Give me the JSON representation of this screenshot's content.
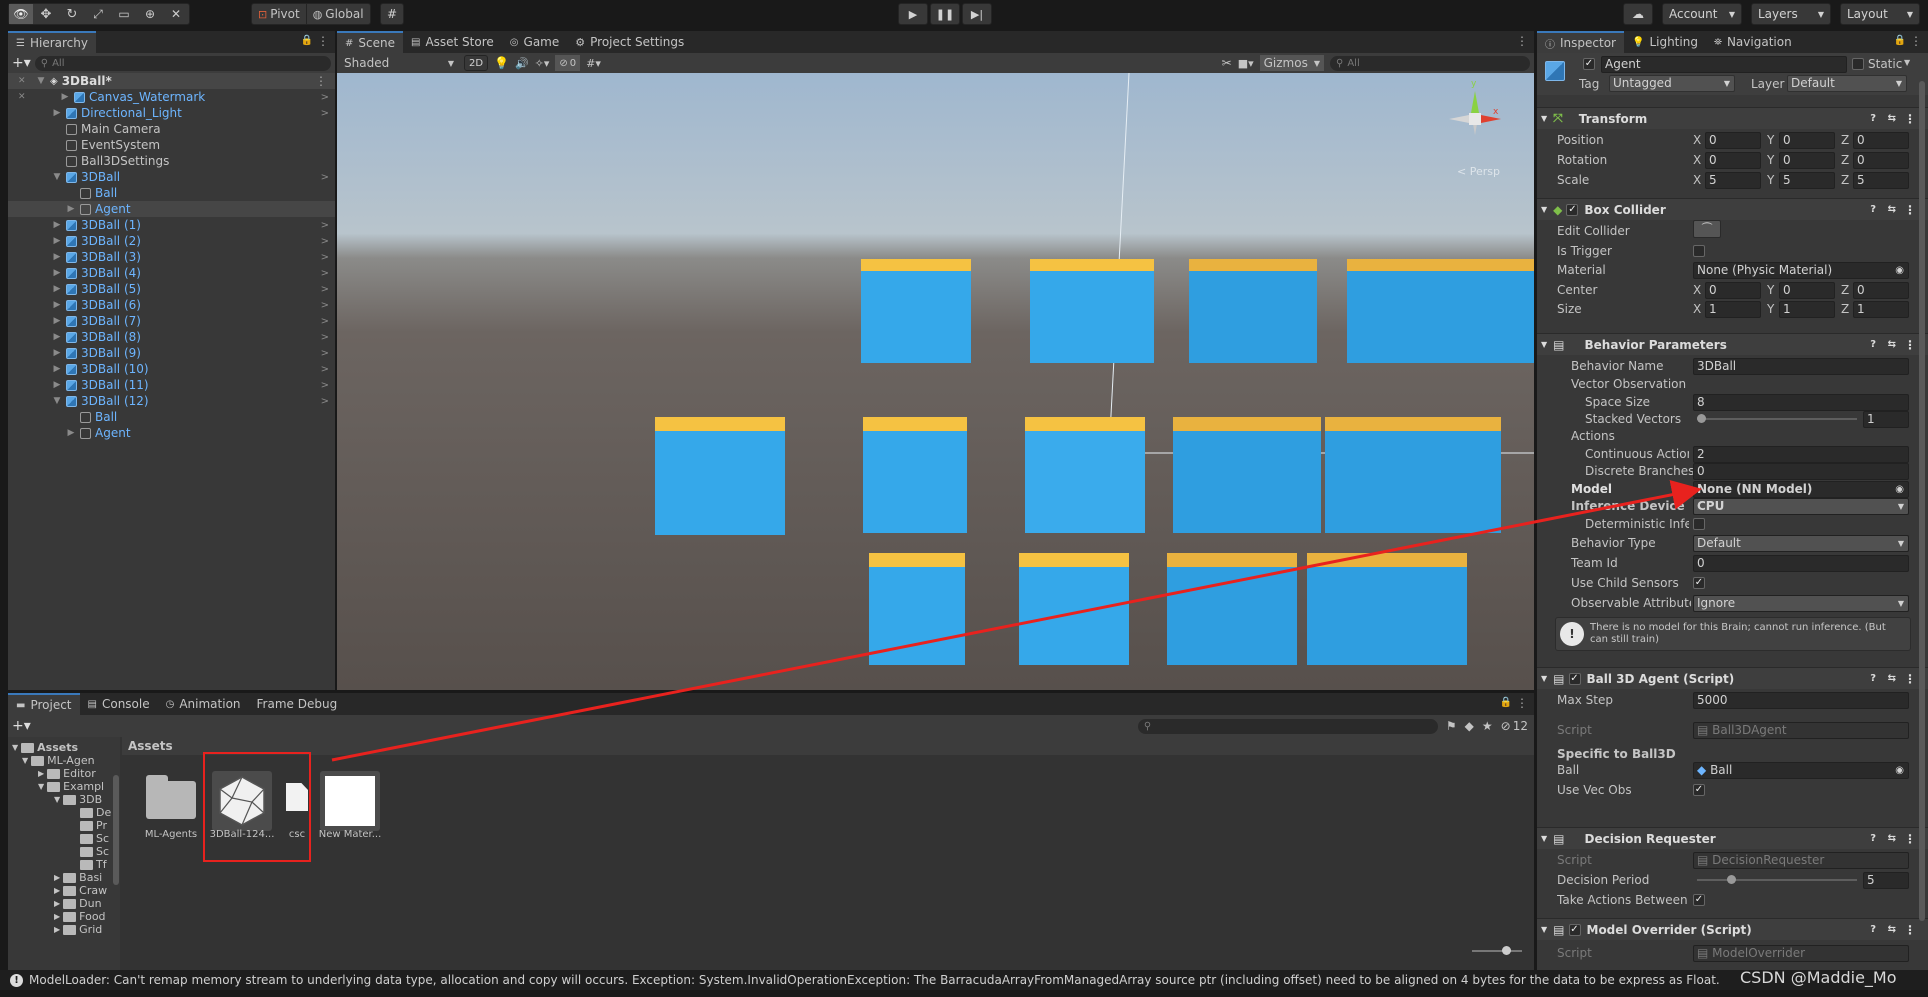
{
  "toolbar": {
    "pivot": "Pivot",
    "global": "Global",
    "account": "Account",
    "layers": "Layers",
    "layout": "Layout"
  },
  "hierarchy": {
    "tab": "Hierarchy",
    "search_placeholder": "All",
    "scene": "3DBall*",
    "items": [
      {
        "label": "Canvas_Watermark",
        "prefab": true
      },
      {
        "label": "Directional_Light",
        "prefab": true
      },
      {
        "label": "Main Camera",
        "prefab": false
      },
      {
        "label": "EventSystem",
        "prefab": false
      },
      {
        "label": "Ball3DSettings",
        "prefab": false
      },
      {
        "label": "3DBall",
        "prefab": true
      },
      {
        "label": "Ball",
        "prefab": false
      },
      {
        "label": "Agent",
        "prefab": false
      },
      {
        "label": "3DBall (1)",
        "prefab": true
      },
      {
        "label": "3DBall (2)",
        "prefab": true
      },
      {
        "label": "3DBall (3)",
        "prefab": true
      },
      {
        "label": "3DBall (4)",
        "prefab": true
      },
      {
        "label": "3DBall (5)",
        "prefab": true
      },
      {
        "label": "3DBall (6)",
        "prefab": true
      },
      {
        "label": "3DBall (7)",
        "prefab": true
      },
      {
        "label": "3DBall (8)",
        "prefab": true
      },
      {
        "label": "3DBall (9)",
        "prefab": true
      },
      {
        "label": "3DBall (10)",
        "prefab": true
      },
      {
        "label": "3DBall (11)",
        "prefab": true
      },
      {
        "label": "3DBall (12)",
        "prefab": true
      },
      {
        "label": "Ball",
        "prefab": false
      },
      {
        "label": "Agent",
        "prefab": false
      }
    ]
  },
  "scene_view": {
    "tabs": [
      "Scene",
      "Asset Store",
      "Game",
      "Project Settings"
    ],
    "shading": "Shaded",
    "mode_2d": "2D",
    "hidden_count": "0",
    "gizmos": "Gizmos",
    "search_placeholder": "All",
    "persp": "< Persp",
    "axis_x": "x",
    "axis_y": "y"
  },
  "project": {
    "tabs": [
      "Project",
      "Console",
      "Animation",
      "Frame Debug"
    ],
    "breadcrumb": "Assets",
    "hidden_count": "12",
    "tree": [
      {
        "label": "Assets",
        "depth": 0
      },
      {
        "label": "ML-Agen",
        "depth": 1
      },
      {
        "label": "Editor",
        "depth": 2
      },
      {
        "label": "Exampl",
        "depth": 2
      },
      {
        "label": "3DB",
        "depth": 3
      },
      {
        "label": "De",
        "depth": 4
      },
      {
        "label": "Pr",
        "depth": 4
      },
      {
        "label": "Sc",
        "depth": 4
      },
      {
        "label": "Sc",
        "depth": 4
      },
      {
        "label": "Tf",
        "depth": 4
      },
      {
        "label": "Basi",
        "depth": 3
      },
      {
        "label": "Craw",
        "depth": 3
      },
      {
        "label": "Dun",
        "depth": 3
      },
      {
        "label": "Food",
        "depth": 3
      },
      {
        "label": "Grid",
        "depth": 3
      }
    ],
    "assets": [
      {
        "label": "ML-Agents",
        "kind": "folder"
      },
      {
        "label": "3DBall-124...",
        "kind": "model"
      },
      {
        "label": "csc",
        "kind": "file"
      },
      {
        "label": "New Mater...",
        "kind": "material"
      }
    ]
  },
  "inspector": {
    "tabs": [
      "Inspector",
      "Lighting",
      "Navigation"
    ],
    "object_name": "Agent",
    "static_label": "Static",
    "tag_label": "Tag",
    "tag_value": "Untagged",
    "layer_label": "Layer",
    "layer_value": "Default",
    "transform": {
      "title": "Transform",
      "rows": [
        {
          "label": "Position",
          "x": "0",
          "y": "0",
          "z": "0"
        },
        {
          "label": "Rotation",
          "x": "0",
          "y": "0",
          "z": "0"
        },
        {
          "label": "Scale",
          "x": "5",
          "y": "5",
          "z": "5"
        }
      ]
    },
    "box_collider": {
      "title": "Box Collider",
      "edit_collider": "Edit Collider",
      "is_trigger": "Is Trigger",
      "material_label": "Material",
      "material_value": "None (Physic Material)",
      "center_label": "Center",
      "center": {
        "x": "0",
        "y": "0",
        "z": "0"
      },
      "size_label": "Size",
      "size": {
        "x": "1",
        "y": "1",
        "z": "1"
      }
    },
    "behavior": {
      "title": "Behavior Parameters",
      "behavior_name_label": "Behavior Name",
      "behavior_name": "3DBall",
      "vector_observation": "Vector Observation",
      "space_size_label": "Space Size",
      "space_size": "8",
      "stacked_vectors_label": "Stacked Vectors",
      "stacked_vectors": "1",
      "stacked_vectors_fraction": 0.0,
      "actions_label": "Actions",
      "continuous_label": "Continuous Actions",
      "continuous": "2",
      "discrete_label": "Discrete Branches",
      "discrete": "0",
      "model_label": "Model",
      "model_value": "None (NN Model)",
      "inference_label": "Inference Device",
      "inference_value": "CPU",
      "deterministic_label": "Deterministic Inference",
      "behavior_type_label": "Behavior Type",
      "behavior_type": "Default",
      "team_id_label": "Team Id",
      "team_id": "0",
      "use_child_label": "Use Child Sensors",
      "observable_label": "Observable Attribute Handling",
      "observable_value": "Ignore",
      "warning": "There is no model for this Brain; cannot run inference. (But can still train)"
    },
    "ball_agent": {
      "title": "Ball 3D Agent (Script)",
      "max_step_label": "Max Step",
      "max_step": "5000",
      "script_label": "Script",
      "script_value": "Ball3DAgent",
      "specific_label": "Specific to Ball3D",
      "ball_label": "Ball",
      "ball_value": "Ball",
      "use_vec_obs_label": "Use Vec Obs"
    },
    "decision": {
      "title": "Decision Requester",
      "script_label": "Script",
      "script_value": "DecisionRequester",
      "period_label": "Decision Period",
      "period": "5",
      "period_fraction": 0.2,
      "take_actions_label": "Take Actions Between Decisions"
    },
    "override": {
      "title": "Model Overrider (Script)",
      "script_label": "Script",
      "script_value": "ModelOverrider"
    }
  },
  "status": {
    "message": "ModelLoader: Can't remap memory stream to underlying data type, allocation and copy will occurs. Exception: System.InvalidOperationException: The BarracudaArrayFromManagedArray source ptr (including offset) need to be aligned on 4 bytes for the data to be express as Float.",
    "watermark": "CSDN @Maddie_Mo"
  },
  "colors": {
    "annotation_red": "#e8221e",
    "selection_blue": "#2c5d87",
    "cube_blue": "#35a8ea",
    "cube_stripe": "#f5c242"
  }
}
